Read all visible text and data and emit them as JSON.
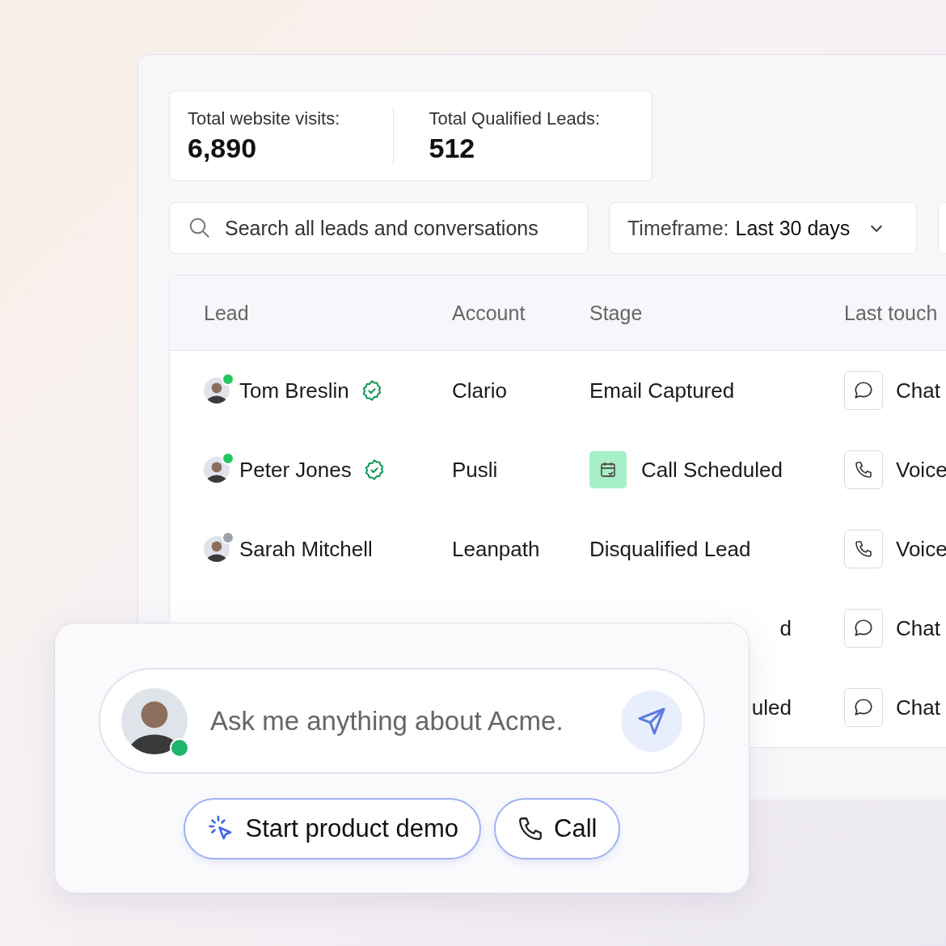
{
  "stats": [
    {
      "label": "Total website visits:",
      "value": "6,890"
    },
    {
      "label": "Total Qualified Leads:",
      "value": "512"
    }
  ],
  "search": {
    "placeholder": "Search all leads and conversations"
  },
  "timeframe": {
    "label": "Timeframe:",
    "value": "Last 30 days"
  },
  "table": {
    "columns": [
      "Lead",
      "Account",
      "Stage",
      "Last touch"
    ],
    "rows": [
      {
        "lead": "Tom Breslin",
        "color": "#22c55e",
        "verified": true,
        "account": "Clario",
        "stage": {
          "kind": "plain",
          "text": "Email Captured"
        },
        "touch": {
          "kind": "chat",
          "label": "Chat"
        }
      },
      {
        "lead": "Peter Jones",
        "color": "#22c55e",
        "verified": true,
        "account": "Pusli",
        "stage": {
          "kind": "scheduled",
          "text": "Call Scheduled"
        },
        "touch": {
          "kind": "voice",
          "label": "Voice"
        }
      },
      {
        "lead": "Sarah Mitchell",
        "color": "#9ca3af",
        "verified": false,
        "account": "Leanpath",
        "stage": {
          "kind": "plain",
          "text": "Disqualified Lead"
        },
        "touch": {
          "kind": "voice",
          "label": "Voice"
        }
      },
      {
        "stage": {
          "kind": "partial",
          "text": "d"
        },
        "touch": {
          "kind": "chat",
          "label": "Chat"
        }
      },
      {
        "stage": {
          "kind": "partial",
          "text": "uled"
        },
        "touch": {
          "kind": "chat",
          "label": "Chat"
        }
      }
    ]
  },
  "assistant": {
    "online": true,
    "placeholder": "Ask me anything about Acme.",
    "actions": [
      {
        "kind": "demo",
        "label": "Start product demo"
      },
      {
        "kind": "call",
        "label": "Call"
      }
    ]
  }
}
